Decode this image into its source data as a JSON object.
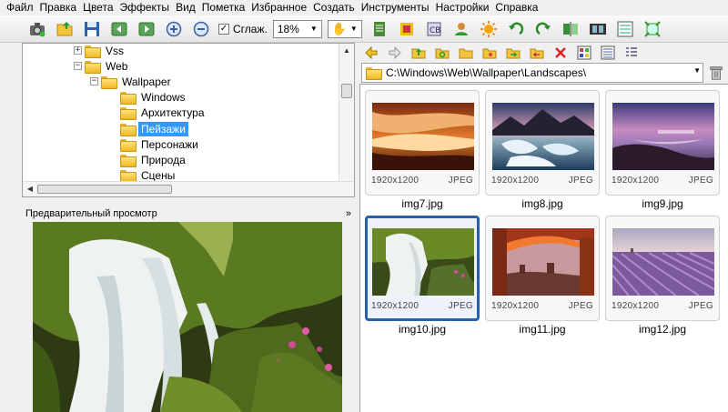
{
  "menu": [
    "Файл",
    "Правка",
    "Цвета",
    "Эффекты",
    "Вид",
    "Пометка",
    "Избранное",
    "Создать",
    "Инструменты",
    "Настройки",
    "Справка"
  ],
  "toolbar": {
    "smooth_label": "Сглаж.",
    "zoom_value": "18%",
    "icons": [
      "camera-icon",
      "open-folder-icon",
      "save-icon",
      "prev-image-icon",
      "next-image-icon",
      "zoom-in-icon",
      "zoom-out-icon"
    ]
  },
  "tree": {
    "items": [
      {
        "label": "Vss",
        "level": 1,
        "expander": "+"
      },
      {
        "label": "Web",
        "level": 1,
        "expander": "−"
      },
      {
        "label": "Wallpaper",
        "level": 2,
        "expander": "−"
      },
      {
        "label": "Windows",
        "level": 3
      },
      {
        "label": "Архитектура",
        "level": 3
      },
      {
        "label": "Пейзажи",
        "level": 3,
        "selected": true
      },
      {
        "label": "Персонажи",
        "level": 3
      },
      {
        "label": "Природа",
        "level": 3
      },
      {
        "label": "Сцены",
        "level": 3
      }
    ]
  },
  "preview": {
    "title": "Предварительный просмотр",
    "collapse_glyph": "»"
  },
  "address": {
    "path": "C:\\Windows\\Web\\Wallpaper\\Landscapes\\"
  },
  "files": [
    {
      "name": "img7.jpg",
      "size": "1920x1200",
      "type": "JPEG"
    },
    {
      "name": "img8.jpg",
      "size": "1920x1200",
      "type": "JPEG"
    },
    {
      "name": "img9.jpg",
      "size": "1920x1200",
      "type": "JPEG"
    },
    {
      "name": "img10.jpg",
      "size": "1920x1200",
      "type": "JPEG",
      "selected": true
    },
    {
      "name": "img11.jpg",
      "size": "1920x1200",
      "type": "JPEG"
    },
    {
      "name": "img12.jpg",
      "size": "1920x1200",
      "type": "JPEG"
    }
  ],
  "colors": {
    "selection": "#3399ff",
    "thumb_border_selected": "#2a5fb0"
  }
}
